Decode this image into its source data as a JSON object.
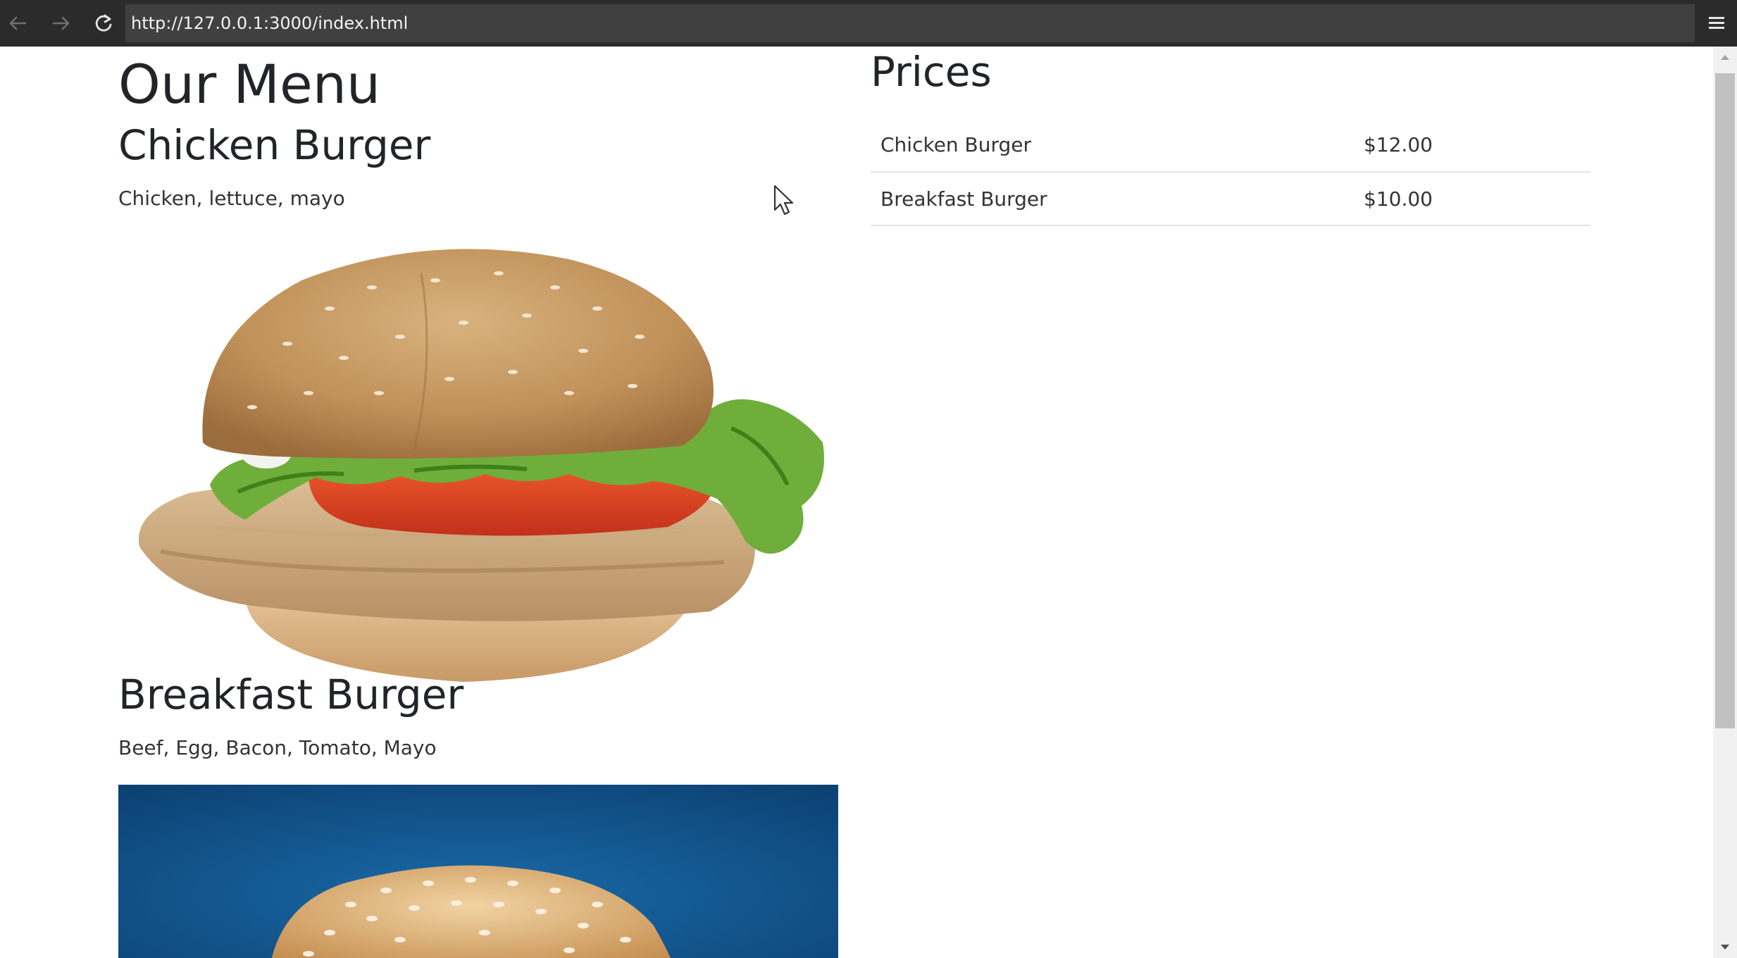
{
  "browser": {
    "url": "http://127.0.0.1:3000/index.html",
    "back_icon": "arrow-left-icon",
    "forward_icon": "arrow-right-icon",
    "reload_icon": "reload-icon",
    "menu_icon": "hamburger-menu-icon"
  },
  "menu": {
    "title": "Our Menu",
    "items": [
      {
        "name": "Chicken Burger",
        "description": "Chicken, lettuce, mayo",
        "image": "chicken-burger-photo"
      },
      {
        "name": "Breakfast Burger",
        "description": "Beef, Egg, Bacon, Tomato, Mayo",
        "image": "breakfast-burger-photo"
      }
    ]
  },
  "prices": {
    "title": "Prices",
    "rows": [
      {
        "item": "Chicken Burger",
        "price": "$12.00"
      },
      {
        "item": "Breakfast Burger",
        "price": "$10.00"
      }
    ]
  },
  "colors": {
    "chrome_bg": "#2b2b2b",
    "url_bg": "#404040",
    "text": "#212529",
    "row_border": "#e3e6e9",
    "photo_backdrop_blue": "#0e4f8a"
  }
}
